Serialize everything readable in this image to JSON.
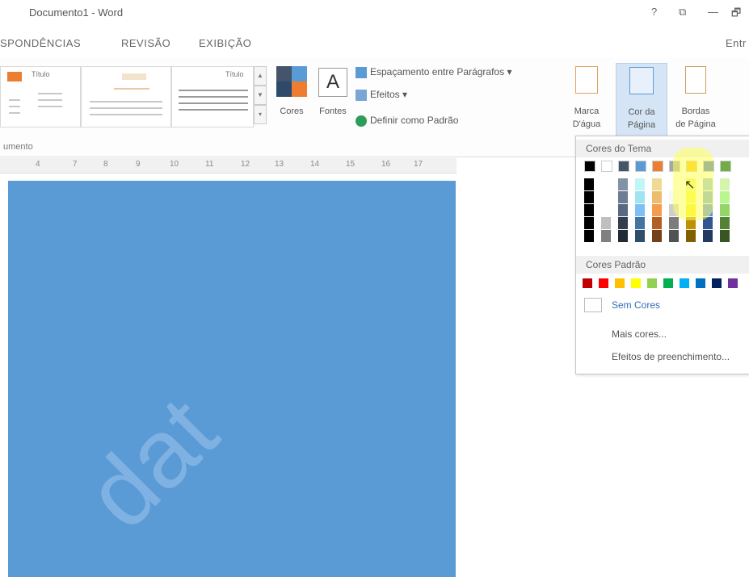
{
  "window": {
    "title": "Documento1 - Word",
    "controls": [
      "?",
      "⧉",
      "—",
      "🗗"
    ]
  },
  "tabs": [
    "SPONDÊNCIAS",
    "REVISÃO",
    "EXIBIÇÃO"
  ],
  "account_label": "Entr",
  "ribbon": {
    "style_gallery": {
      "first_label": "Título",
      "third_label": "Título"
    },
    "cores_label": "Cores",
    "fontes_label": "Fontes",
    "fontes_glyph": "A",
    "espacamento_label": "Espaçamento entre Parágrafos",
    "efeitos_label": "Efeitos",
    "definir_padrao_label": "Definir como Padrão",
    "marca_dagua_label": [
      "Marca",
      "D'água"
    ],
    "cor_pagina_label": [
      "Cor da",
      "Página"
    ],
    "bordas_label": [
      "Bordas",
      "de Página"
    ],
    "group_label": "umento"
  },
  "ruler_marks": [
    "4",
    "7",
    "8",
    "9",
    "10",
    "11",
    "12",
    "13",
    "14",
    "15",
    "16",
    "17"
  ],
  "document": {
    "page_color": "#5b9bd5",
    "watermark_text": "dat"
  },
  "dropdown": {
    "theme_header": "Cores do Tema",
    "standard_header": "Cores Padrão",
    "no_color": "Sem Cores",
    "more_colors": "Mais cores...",
    "fill_effects": "Efeitos de preenchimento...",
    "theme_top_colors": [
      "#000000",
      "#ffffff",
      "#44546a",
      "#5b9bd5",
      "#ed7d31",
      "#a5a5a5",
      "#ffc000",
      "#4472c4",
      "#70ad47"
    ],
    "standard_colors": [
      "#c00000",
      "#ff0000",
      "#ffc000",
      "#ffff00",
      "#92d050",
      "#00b050",
      "#00b0f0",
      "#0070c0",
      "#002060",
      "#7030a0"
    ]
  }
}
